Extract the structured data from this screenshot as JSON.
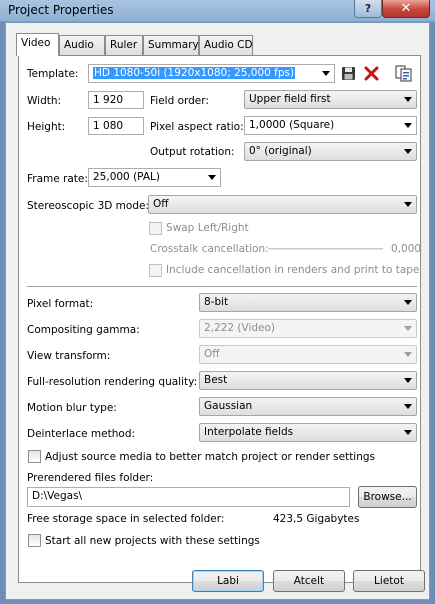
{
  "window": {
    "title": "Project Properties",
    "help_label": "?",
    "close_label": "✕"
  },
  "tabs": [
    {
      "label": "Video"
    },
    {
      "label": "Audio"
    },
    {
      "label": "Ruler"
    },
    {
      "label": "Summary"
    },
    {
      "label": "Audio CD"
    }
  ],
  "template": {
    "label": "Template:",
    "value": "HD 1080-50i (1920x1080; 25,000 fps)"
  },
  "width": {
    "label": "Width:",
    "value": "1 920"
  },
  "height": {
    "label": "Height:",
    "value": "1 080"
  },
  "field_order": {
    "label": "Field order:",
    "value": "Upper field first"
  },
  "pixel_aspect": {
    "label": "Pixel aspect ratio:",
    "value": "1,0000 (Square)"
  },
  "output_rotation": {
    "label": "Output rotation:",
    "value": "0° (original)"
  },
  "frame_rate": {
    "label": "Frame rate:",
    "value": "25,000 (PAL)"
  },
  "stereo_mode": {
    "label": "Stereoscopic 3D mode:",
    "value": "Off"
  },
  "swap_lr": {
    "label": "Swap Left/Right"
  },
  "crosstalk": {
    "label": "Crosstalk cancellation:",
    "value": "0,000"
  },
  "include_cancel": {
    "label": "Include cancellation in renders and print to tape"
  },
  "pixel_format": {
    "label": "Pixel format:",
    "value": "8-bit"
  },
  "compositing_gamma": {
    "label": "Compositing gamma:",
    "value": "2,222 (Video)"
  },
  "view_transform": {
    "label": "View transform:",
    "value": "Off"
  },
  "render_quality": {
    "label": "Full-resolution rendering quality:",
    "value": "Best"
  },
  "motion_blur": {
    "label": "Motion blur type:",
    "value": "Gaussian"
  },
  "deinterlace": {
    "label": "Deinterlace method:",
    "value": "Interpolate fields"
  },
  "adjust_source": {
    "label": "Adjust source media to better match project or render settings"
  },
  "prerender": {
    "label": "Prerendered files folder:",
    "value": "D:\\Vegas\\",
    "browse_label": "Browse..."
  },
  "free_space": {
    "label": "Free storage space in selected folder:",
    "value": "423,5 Gigabytes"
  },
  "start_all": {
    "label": "Start all new projects with these settings"
  },
  "buttons": {
    "ok": "Labi",
    "cancel": "Atcelt",
    "apply": "Lietot"
  }
}
